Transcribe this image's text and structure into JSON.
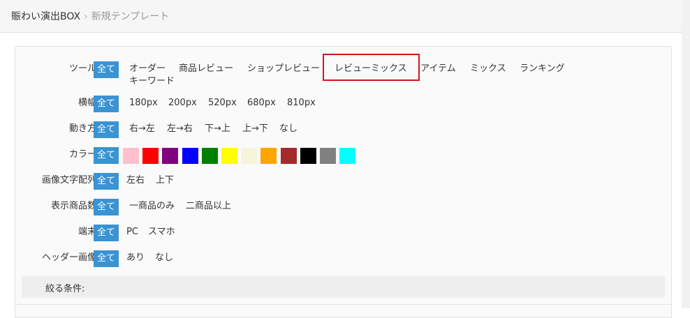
{
  "breadcrumb": {
    "root": "賑わい演出BOX",
    "separator": "›",
    "current": "新規テンプレート"
  },
  "all_label": "全て",
  "rows": {
    "tool": {
      "label": "ツール：",
      "options": [
        "オーダー",
        "商品レビュー",
        "ショップレビュー",
        "レビューミックス",
        "アイテム",
        "ミックス",
        "ランキング",
        "キーワード"
      ],
      "highlighted": "レビューミックス"
    },
    "width": {
      "label": "横幅：",
      "options": [
        "180px",
        "200px",
        "520px",
        "680px",
        "810px"
      ]
    },
    "motion": {
      "label": "動き方：",
      "options": [
        "右→左",
        "左→右",
        "下→上",
        "上→下",
        "なし"
      ]
    },
    "color": {
      "label": "カラー：",
      "swatches": [
        "#ffc0cb",
        "#ff0000",
        "#800080",
        "#0000ff",
        "#008000",
        "#ffff00",
        "#f5f5dc",
        "#ffa500",
        "#a52a2a",
        "#000000",
        "#808080",
        "#00ffff"
      ]
    },
    "layout": {
      "label": "画像文字配列：",
      "options": [
        "左右",
        "上下"
      ]
    },
    "count": {
      "label": "表示商品数：",
      "options": [
        "一商品のみ",
        "二商品以上"
      ]
    },
    "device": {
      "label": "端末：",
      "options": [
        "PC",
        "スマホ"
      ]
    },
    "header_image": {
      "label": "ヘッダー画像：",
      "options": [
        "あり",
        "なし"
      ]
    }
  },
  "filter_bar": {
    "label": "絞る条件:"
  },
  "colors": {
    "accent": "#3a93d2",
    "highlight_border": "#d6141b"
  }
}
